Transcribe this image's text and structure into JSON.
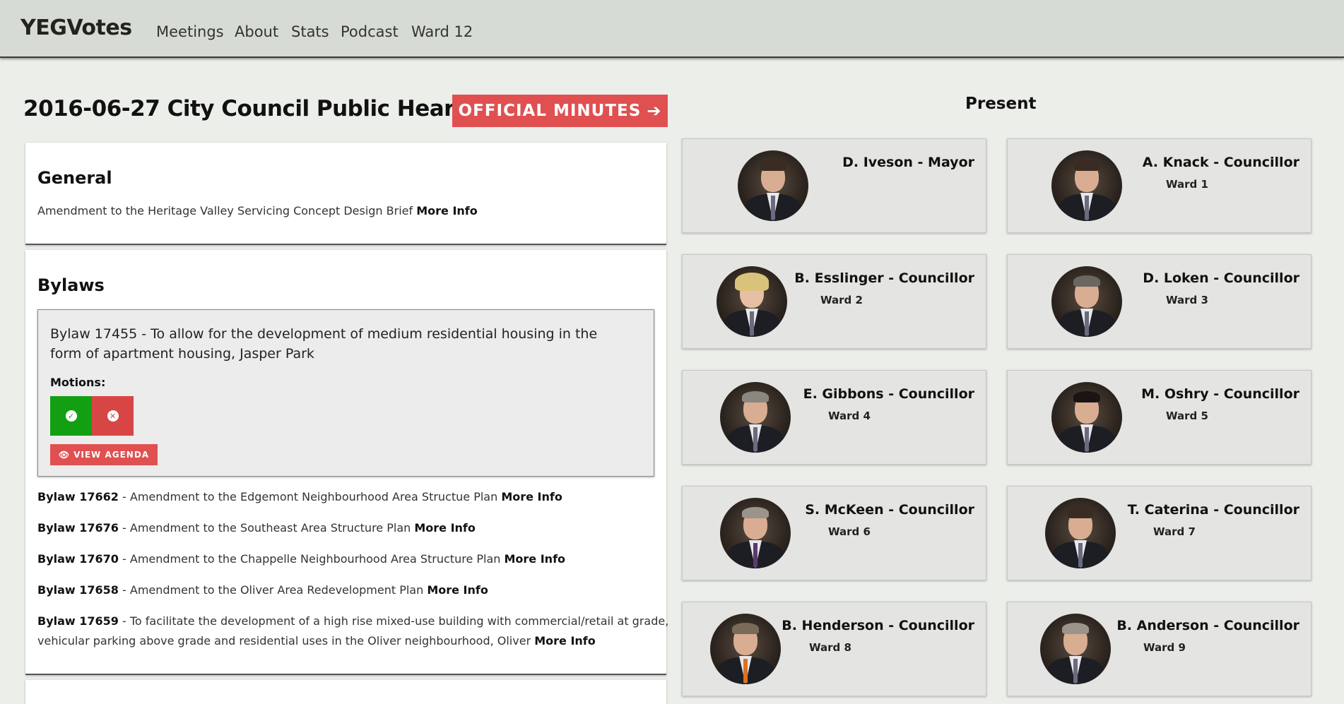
{
  "navbar": {
    "brand": "YEGVotes",
    "items": [
      "Meetings",
      "About",
      "Stats",
      "Podcast",
      "Ward 12"
    ]
  },
  "page": {
    "title": "2016-06-27 City Council Public Hearing",
    "minutes_button": "OFFICIAL MINUTES"
  },
  "general": {
    "heading": "General",
    "items": [
      {
        "text": "Amendment to the Heritage Valley Servicing Concept Design Brief",
        "link": "More Info"
      }
    ]
  },
  "bylaws": {
    "heading": "Bylaws",
    "featured": {
      "text": "Bylaw 17455 - To allow for the development of medium residential housing in the form of apartment housing, Jasper Park",
      "motions_label": "Motions:",
      "agenda_button": "VIEW AGENDA"
    },
    "items": [
      {
        "id": "Bylaw 17662",
        "text": " - Amendment to the Edgemont Neighbourhood Area Structue Plan ",
        "link": "More Info"
      },
      {
        "id": "Bylaw 17676",
        "text": " - Amendment to the Southeast Area Structure Plan ",
        "link": "More Info"
      },
      {
        "id": "Bylaw 17670",
        "text": " - Amendment to the Chappelle Neighbourhood Area Structure Plan ",
        "link": "More Info"
      },
      {
        "id": "Bylaw 17658",
        "text": " - Amendment to the Oliver Area Redevelopment Plan ",
        "link": "More Info"
      },
      {
        "id": "Bylaw 17659",
        "text": " - To facilitate the development of a high rise mixed-use building with commercial/retail at grade,",
        "text2": "vehicular parking above grade and residential uses in the Oliver neighbourhood, Oliver ",
        "link": "More Info"
      }
    ]
  },
  "present": {
    "heading": "Present",
    "members": [
      {
        "name": "D. Iveson - Mayor",
        "ward": ""
      },
      {
        "name": "A. Knack - Councillor",
        "ward": "Ward 1"
      },
      {
        "name": "B. Esslinger - Councillor",
        "ward": "Ward 2"
      },
      {
        "name": "D. Loken - Councillor",
        "ward": "Ward 3"
      },
      {
        "name": "E. Gibbons - Councillor",
        "ward": "Ward 4"
      },
      {
        "name": "M. Oshry - Councillor",
        "ward": "Ward 5"
      },
      {
        "name": "S. McKeen - Councillor",
        "ward": "Ward 6"
      },
      {
        "name": "T. Caterina - Councillor",
        "ward": "Ward 7"
      },
      {
        "name": "B. Henderson - Councillor",
        "ward": "Ward 8"
      },
      {
        "name": "B. Anderson - Councillor",
        "ward": "Ward 9"
      }
    ]
  },
  "colors": {
    "navbar": "#d6dcd3",
    "accent": "#e05050",
    "vote_yes": "#12a012",
    "vote_no": "#d84545",
    "card": "#e4e4e2"
  }
}
